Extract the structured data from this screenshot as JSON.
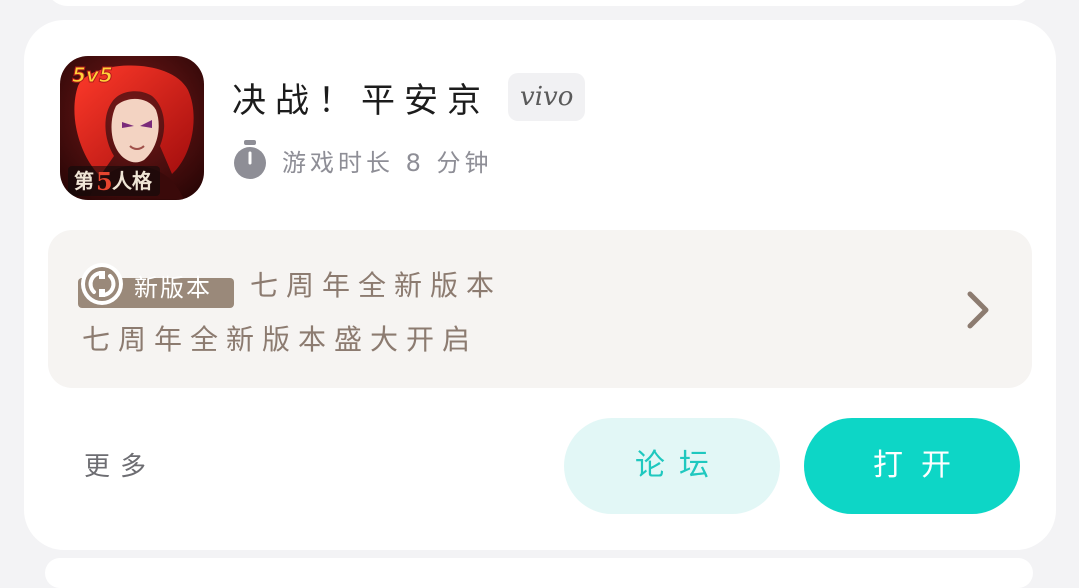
{
  "game": {
    "title": "决战！平安京",
    "platform_badge": "vivo",
    "playtime": "游戏时长 8 分钟",
    "icon": "game-app-icon"
  },
  "news": {
    "tag_label": "新版本",
    "headline": "七周年全新版本",
    "subtitle": "七周年全新版本盛大开启",
    "tag_icon": "refresh-circle-icon",
    "arrow_icon": "chevron-right-icon"
  },
  "actions": {
    "more_label": "更多",
    "forum_label": "论坛",
    "open_label": "打开"
  },
  "colors": {
    "accent": "#0dd6c6",
    "accent_soft": "#e2f7f6",
    "news_bg": "#f6f4f2",
    "news_text": "#8c7b70",
    "tag_bg": "#9a897a"
  }
}
